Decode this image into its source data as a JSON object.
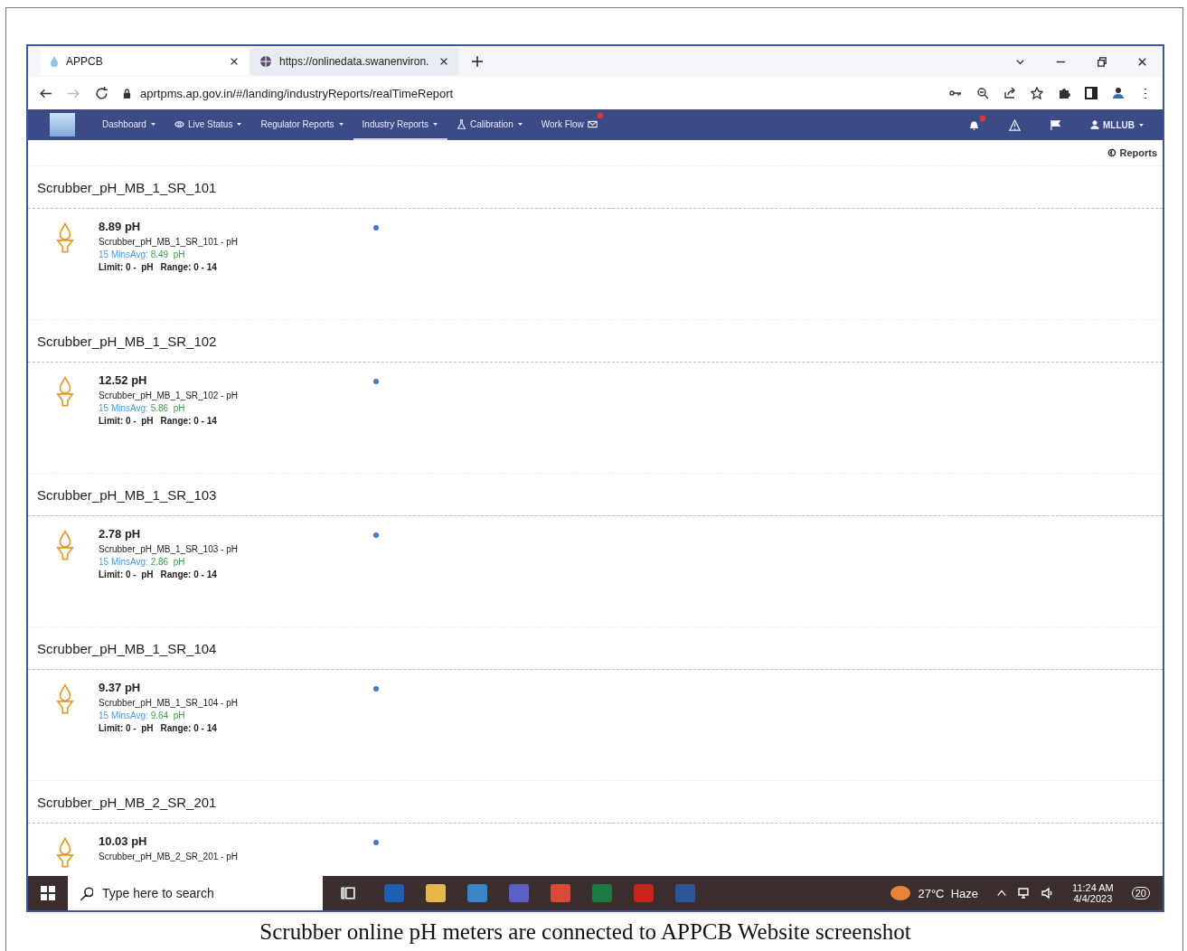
{
  "browser": {
    "tabs": [
      {
        "title": "APPCB",
        "selected": true
      },
      {
        "title": "https://onlinedata.swanenviron.",
        "selected": false
      }
    ],
    "url": "aprtpms.ap.gov.in/#/landing/industryReports/realTimeReport"
  },
  "nav": {
    "items": [
      {
        "label": "Dashboard",
        "dropdown": true,
        "selected": false,
        "badge": false
      },
      {
        "label": "Live Status",
        "dropdown": true,
        "selected": false,
        "badge": false
      },
      {
        "label": "Regulator Reports",
        "dropdown": true,
        "selected": false,
        "badge": false
      },
      {
        "label": "Industry Reports",
        "dropdown": true,
        "selected": true,
        "badge": false
      },
      {
        "label": "Calibration",
        "dropdown": true,
        "selected": false,
        "badge": false
      },
      {
        "label": "Work Flow",
        "dropdown": false,
        "selected": false,
        "badge": true
      }
    ],
    "bell_badge": true,
    "user": "MLLUB"
  },
  "reports_link": "Reports",
  "sections": [
    {
      "title": "Scrubber_pH_MB_1_SR_101",
      "reading": "8.89 pH",
      "parameter": "Scrubber_pH_MB_1_SR_101 - pH",
      "avg_label": "15 MinsAvg:",
      "avg_value": "8.49  pH",
      "limit": "Limit: 0 -  pH",
      "range": "Range: 0 - 14"
    },
    {
      "title": "Scrubber_pH_MB_1_SR_102",
      "reading": "12.52 pH",
      "parameter": "Scrubber_pH_MB_1_SR_102 - pH",
      "avg_label": "15 MinsAvg:",
      "avg_value": "5.86  pH",
      "limit": "Limit: 0 -  pH",
      "range": "Range: 0 - 14"
    },
    {
      "title": "Scrubber_pH_MB_1_SR_103",
      "reading": "2.78 pH",
      "parameter": "Scrubber_pH_MB_1_SR_103 - pH",
      "avg_label": "15 MinsAvg:",
      "avg_value": "2.86  pH",
      "limit": "Limit: 0 -  pH",
      "range": "Range: 0 - 14"
    },
    {
      "title": "Scrubber_pH_MB_1_SR_104",
      "reading": "9.37 pH",
      "parameter": "Scrubber_pH_MB_1_SR_104 - pH",
      "avg_label": "15 MinsAvg:",
      "avg_value": "9.64  pH",
      "limit": "Limit: 0 -  pH",
      "range": "Range: 0 - 14"
    },
    {
      "title": "Scrubber_pH_MB_2_SR_201",
      "reading": "10.03 pH",
      "parameter": "Scrubber_pH_MB_2_SR_201 - pH"
    }
  ],
  "taskbar": {
    "search_placeholder": "Type here to search",
    "weather": "27°C  Haze",
    "time": "11:24 AM",
    "date": "4/4/2023",
    "notifications": "20"
  },
  "caption": "Scrubber online pH meters are connected to APPCB Website screenshot"
}
